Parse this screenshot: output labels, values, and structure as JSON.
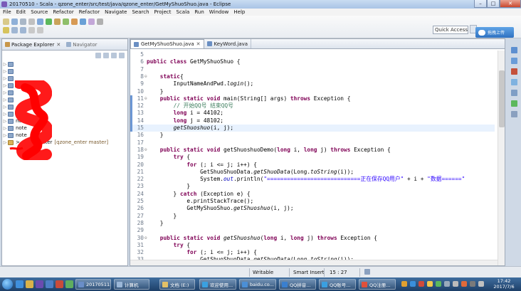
{
  "window": {
    "title": "20170510 - Scala - qzone_enter/src/test/java/qzone_enter/GetMyShuoShuo.java - Eclipse",
    "minimize": "–",
    "maximize": "□",
    "close": "✕"
  },
  "menu": [
    "File",
    "Edit",
    "Source",
    "Refactor",
    "Refactor",
    "Navigate",
    "Search",
    "Project",
    "Scala",
    "Run",
    "Window",
    "Help"
  ],
  "toolbar": {
    "quick_access": "Quick Access",
    "upload_label": "拖拽上传"
  },
  "left_panel": {
    "tab_package_explorer": "Package Explorer",
    "tab_navigator": "Navigator",
    "tree": [
      {
        "label": "",
        "deco": ""
      },
      {
        "label": "",
        "deco": ""
      },
      {
        "label": "",
        "deco": ""
      },
      {
        "label": "",
        "deco": ""
      },
      {
        "label": "",
        "deco": ""
      },
      {
        "label": "",
        "deco": ""
      },
      {
        "label": "",
        "deco": ""
      },
      {
        "label": "",
        "deco": ""
      },
      {
        "label": "note",
        "deco": ""
      },
      {
        "label": "note",
        "deco": ""
      },
      {
        "label": "note",
        "deco": ""
      },
      {
        "label": "> qzone_enter",
        "deco": "[qzone_enter master]"
      }
    ]
  },
  "editor": {
    "tabs": [
      {
        "label": "GetMyShuoShuo.java",
        "active": true
      },
      {
        "label": "KeyWord.java",
        "active": false
      }
    ],
    "current_line": 15,
    "lines": [
      {
        "n": "5",
        "code": ""
      },
      {
        "n": "6",
        "code": "public class GetMyShuoShuo {"
      },
      {
        "n": "7",
        "code": ""
      },
      {
        "n": "8",
        "code": "    static{"
      },
      {
        "n": "9",
        "code": "        InputNameAndPwd.login();"
      },
      {
        "n": "10",
        "code": "    }"
      },
      {
        "n": "11",
        "code": "    public static void main(String[] args) throws Exception {"
      },
      {
        "n": "12",
        "code": "        // 开始QQ号 结束QQ号"
      },
      {
        "n": "13",
        "code": "        long i = 44102;"
      },
      {
        "n": "14",
        "code": "        long j = 48102;"
      },
      {
        "n": "15",
        "code": "        getShuoshuo(i, j);"
      },
      {
        "n": "16",
        "code": "    }"
      },
      {
        "n": "17",
        "code": ""
      },
      {
        "n": "18",
        "code": "    public static void getShuoshuoDemo(long i, long j) throws Exception {"
      },
      {
        "n": "19",
        "code": "        try {"
      },
      {
        "n": "20",
        "code": "            for (; i <= j; i++) {"
      },
      {
        "n": "21",
        "code": "                GetShuoShuoData.getShuoData(Long.toString(i));"
      },
      {
        "n": "22",
        "code": "                System.out.println(\"============================正在保存QQ用户\" + i + \"数据======\""
      },
      {
        "n": "23",
        "code": "            }"
      },
      {
        "n": "24",
        "code": "        } catch (Exception e) {"
      },
      {
        "n": "25",
        "code": "            e.printStackTrace();"
      },
      {
        "n": "26",
        "code": "            GetMyShuoShuo.getShuoshuo(i, j);"
      },
      {
        "n": "27",
        "code": "        }"
      },
      {
        "n": "28",
        "code": "    }"
      },
      {
        "n": "29",
        "code": ""
      },
      {
        "n": "30",
        "code": "    public static void getShuoshuo(long i, long j) throws Exception {"
      },
      {
        "n": "31",
        "code": "        try {"
      },
      {
        "n": "32",
        "code": "            for (; i <= j; i++) {"
      },
      {
        "n": "33",
        "code": "                GetShuoShuoData.getShuoData(Long.toString(i));"
      }
    ]
  },
  "status": {
    "writable": "Writable",
    "insert_mode": "Smart Insert",
    "position": "15 : 27"
  },
  "taskbar": {
    "buttons": [
      {
        "label": "20170511...",
        "color": "#6a8ec8"
      },
      {
        "label": "计算机",
        "color": "#9bb7d8"
      },
      {
        "label": "文档 (E:)",
        "color": "#e3c066"
      },
      {
        "label": "欢迎使用...",
        "color": "#3aa0e0"
      },
      {
        "label": "baidu.co...",
        "color": "#4b8fd6"
      },
      {
        "label": "QQ拼音...",
        "color": "#3a7fcf"
      },
      {
        "label": "QQ账号...",
        "color": "#3a9fe0"
      },
      {
        "label": "QQ注册...",
        "color": "#e0503a"
      }
    ],
    "clock_time": "17:42",
    "clock_date": "2017/7/6"
  }
}
